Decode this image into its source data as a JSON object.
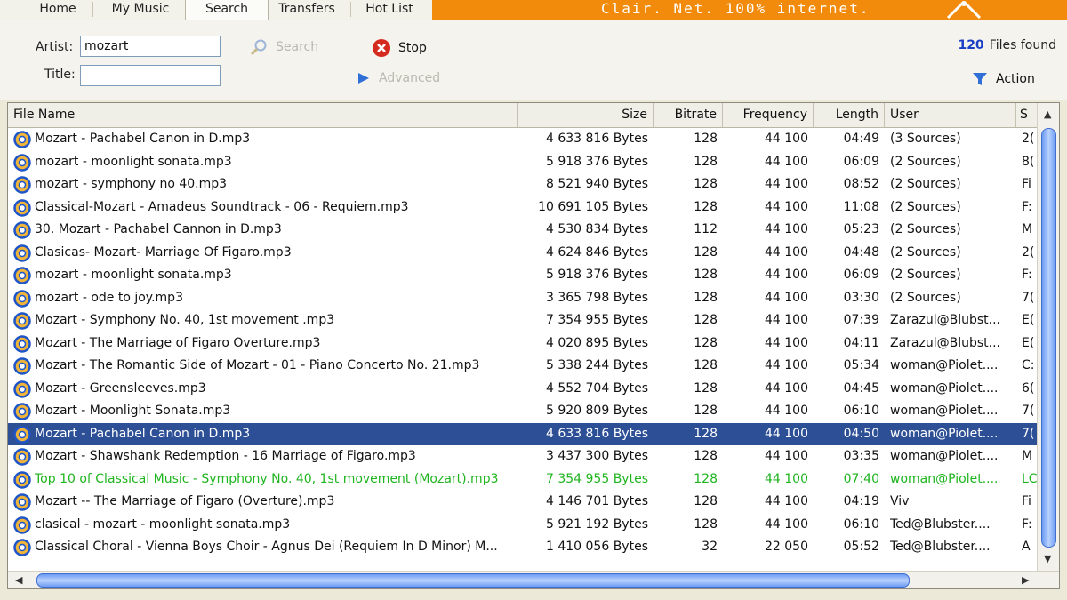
{
  "nav": {
    "tabs": [
      {
        "label": "Home"
      },
      {
        "label": "My Music"
      },
      {
        "label": "Search"
      },
      {
        "label": "Transfers"
      },
      {
        "label": "Hot List"
      }
    ],
    "banner_text": "Clair. Net. 100% internet.",
    "banner_color": "#f28b0c"
  },
  "search": {
    "artist_label": "Artist:",
    "artist_value": "mozart",
    "title_label": "Title:",
    "title_value": "",
    "search_label": "Search",
    "stop_label": "Stop",
    "advanced_label": "Advanced",
    "files_found_count": "120",
    "files_found_label": "Files found",
    "action_label": "Action"
  },
  "table": {
    "columns": [
      "File Name",
      "Size",
      "Bitrate",
      "Frequency",
      "Length",
      "User",
      "S"
    ],
    "rows": [
      {
        "name": "Mozart - Pachabel Canon in D.mp3",
        "size": "4 633 816 Bytes",
        "bitrate": "128",
        "frequency": "44 100",
        "length": "04:49",
        "user": "(3 Sources)",
        "extra": "2("
      },
      {
        "name": "mozart - moonlight sonata.mp3",
        "size": "5 918 376 Bytes",
        "bitrate": "128",
        "frequency": "44 100",
        "length": "06:09",
        "user": "(2 Sources)",
        "extra": "8("
      },
      {
        "name": "mozart - symphony no 40.mp3",
        "size": "8 521 940 Bytes",
        "bitrate": "128",
        "frequency": "44 100",
        "length": "08:52",
        "user": "(2 Sources)",
        "extra": "Fi"
      },
      {
        "name": "Classical-Mozart - Amadeus Soundtrack - 06 - Requiem.mp3",
        "size": "10 691 105 Bytes",
        "bitrate": "128",
        "frequency": "44 100",
        "length": "11:08",
        "user": "(2 Sources)",
        "extra": "F:"
      },
      {
        "name": "30. Mozart - Pachabel Cannon in D.mp3",
        "size": "4 530 834 Bytes",
        "bitrate": "112",
        "frequency": "44 100",
        "length": "05:23",
        "user": "(2 Sources)",
        "extra": "M"
      },
      {
        "name": "Clasicas- Mozart- Marriage Of Figaro.mp3",
        "size": "4 624 846 Bytes",
        "bitrate": "128",
        "frequency": "44 100",
        "length": "04:48",
        "user": "(2 Sources)",
        "extra": "2("
      },
      {
        "name": "mozart - moonlight sonata.mp3",
        "size": "5 918 376 Bytes",
        "bitrate": "128",
        "frequency": "44 100",
        "length": "06:09",
        "user": "(2 Sources)",
        "extra": "F:"
      },
      {
        "name": "mozart - ode to joy.mp3",
        "size": "3 365 798 Bytes",
        "bitrate": "128",
        "frequency": "44 100",
        "length": "03:30",
        "user": "(2 Sources)",
        "extra": "7("
      },
      {
        "name": "Mozart - Symphony No. 40, 1st movement .mp3",
        "size": "7 354 955 Bytes",
        "bitrate": "128",
        "frequency": "44 100",
        "length": "07:39",
        "user": "Zarazul@Blubst...",
        "extra": "E("
      },
      {
        "name": "Mozart - The Marriage of Figaro Overture.mp3",
        "size": "4 020 895 Bytes",
        "bitrate": "128",
        "frequency": "44 100",
        "length": "04:11",
        "user": "Zarazul@Blubst...",
        "extra": "E("
      },
      {
        "name": "Mozart  - The Romantic Side of Mozart - 01 - Piano Concerto No. 21.mp3",
        "size": "5 338 244 Bytes",
        "bitrate": "128",
        "frequency": "44 100",
        "length": "05:34",
        "user": "woman@Piolet....",
        "extra": "C:"
      },
      {
        "name": "Mozart - Greensleeves.mp3",
        "size": "4 552 704 Bytes",
        "bitrate": "128",
        "frequency": "44 100",
        "length": "04:45",
        "user": "woman@Piolet....",
        "extra": "6("
      },
      {
        "name": "Mozart - Moonlight Sonata.mp3",
        "size": "5 920 809 Bytes",
        "bitrate": "128",
        "frequency": "44 100",
        "length": "06:10",
        "user": "woman@Piolet....",
        "extra": "7("
      },
      {
        "name": "Mozart - Pachabel Canon in D.mp3",
        "size": "4 633 816 Bytes",
        "bitrate": "128",
        "frequency": "44 100",
        "length": "04:50",
        "user": "woman@Piolet....",
        "extra": "7(",
        "selected": true
      },
      {
        "name": "Mozart - Shawshank Redemption - 16 Marriage of Figaro.mp3",
        "size": "3 437 300 Bytes",
        "bitrate": "128",
        "frequency": "44 100",
        "length": "03:35",
        "user": "woman@Piolet....",
        "extra": "M"
      },
      {
        "name": "Top 10 of Classical Music - Symphony No. 40, 1st movement (Mozart).mp3",
        "size": "7 354 955 Bytes",
        "bitrate": "128",
        "frequency": "44 100",
        "length": "07:40",
        "user": "woman@Piolet....",
        "extra": "LC",
        "highlight": true
      },
      {
        "name": "Mozart -- The Marriage of Figaro (Overture).mp3",
        "size": "4 146 701 Bytes",
        "bitrate": "128",
        "frequency": "44 100",
        "length": "04:19",
        "user": "Viv",
        "extra": "Fi"
      },
      {
        "name": "clasical - mozart - moonlight sonata.mp3",
        "size": "5 921 192 Bytes",
        "bitrate": "128",
        "frequency": "44 100",
        "length": "06:10",
        "user": "Ted@Blubster....",
        "extra": "F:"
      },
      {
        "name": "Classical Choral - Vienna Boys Choir - Agnus Dei (Requiem In D Minor) M...",
        "size": "1 410 056 Bytes",
        "bitrate": "32",
        "frequency": "22 050",
        "length": "05:52",
        "user": "Ted@Blubster....",
        "extra": "A"
      }
    ]
  }
}
